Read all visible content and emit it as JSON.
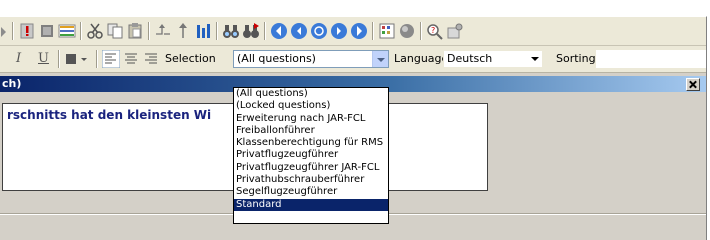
{
  "toolbar2": {
    "selection_label": "Selection",
    "selection_value": "(All questions)",
    "language_label": "Language",
    "language_value": "Deutsch",
    "sorting_label": "Sorting",
    "italic_label": "I",
    "underline_label": "U"
  },
  "window": {
    "title": "ch)",
    "question_text": "rschnitts hat den kleinsten Wi"
  },
  "dropdown": {
    "options": [
      "(All questions)",
      "(Locked questions)",
      "Erweiterung nach JAR-FCL",
      "Freiballonführer",
      "Klassenberechtigung für RMS",
      "Privatflugzeugführer",
      "Privatflugzeugführer JAR-FCL",
      "Privathubschrauberführer",
      "Segelflugzeugführer",
      "Standard"
    ],
    "selected": "Standard"
  },
  "colors": {
    "toolbar_bg": "#ece9d8",
    "window_bg": "#d4d0c8",
    "title_gradient_start": "#0a246a",
    "question_text": "#1a237e",
    "selection_highlight": "#0a246a"
  },
  "icons": [
    "arrow-icon",
    "exclamation-icon",
    "stop-icon",
    "list-icon",
    "cut-icon",
    "copy-icon",
    "paste-icon",
    "move-icon",
    "up-arrow-icon",
    "bar-chart-icon",
    "binoculars-icon",
    "binoculars-next-icon",
    "first-icon",
    "prev-icon",
    "refresh-icon",
    "next-icon",
    "last-icon",
    "grid-icon",
    "sphere-icon",
    "search-question-icon",
    "settings-icon"
  ]
}
